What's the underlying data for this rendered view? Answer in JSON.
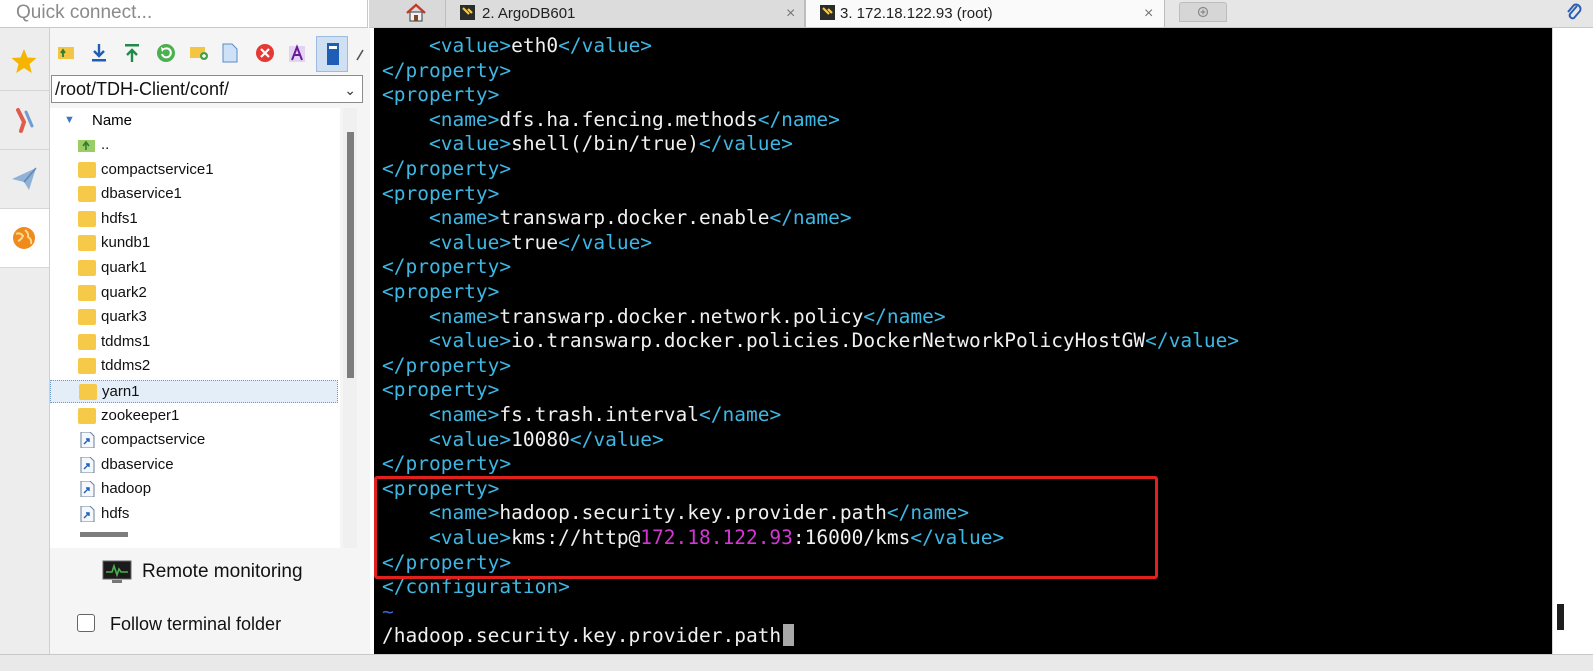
{
  "quick_connect": {
    "placeholder": "Quick connect..."
  },
  "tabs": [
    {
      "label": "",
      "icon": "home-icon",
      "active": false
    },
    {
      "label": "2. ArgoDB601",
      "icon": "terminal-tab-icon",
      "close": "×",
      "active": false
    },
    {
      "label": "3. 172.18.122.93 (root)",
      "icon": "terminal-tab-icon",
      "close": "×",
      "active": true
    },
    {
      "label": "",
      "icon": "new-tab-icon",
      "active": false
    }
  ],
  "left_strip": [
    "star-icon",
    "tools-icon",
    "paper-plane-icon",
    "globe-icon"
  ],
  "file_browser": {
    "toolbar": [
      "up-folder-icon",
      "download-icon",
      "upload-icon",
      "refresh-icon",
      "new-folder-icon",
      "new-file-icon",
      "delete-icon",
      "rename-icon",
      "toggle-view-icon"
    ],
    "path": "/root/TDH-Client/conf/",
    "name_header": "Name",
    "rows": [
      {
        "name": "..",
        "type": "parent"
      },
      {
        "name": "compactservice1",
        "type": "folder"
      },
      {
        "name": "dbaservice1",
        "type": "folder"
      },
      {
        "name": "hdfs1",
        "type": "folder"
      },
      {
        "name": "kundb1",
        "type": "folder"
      },
      {
        "name": "quark1",
        "type": "folder"
      },
      {
        "name": "quark2",
        "type": "folder"
      },
      {
        "name": "quark3",
        "type": "folder"
      },
      {
        "name": "tddms1",
        "type": "folder"
      },
      {
        "name": "tddms2",
        "type": "folder"
      },
      {
        "name": "yarn1",
        "type": "folder",
        "selected": true
      },
      {
        "name": "zookeeper1",
        "type": "folder"
      },
      {
        "name": "compactservice",
        "type": "link"
      },
      {
        "name": "dbaservice",
        "type": "link"
      },
      {
        "name": "hadoop",
        "type": "link"
      },
      {
        "name": "hdfs",
        "type": "link"
      }
    ],
    "remote_monitoring": "Remote monitoring",
    "follow_terminal_folder": "Follow terminal folder",
    "follow_checked": false
  },
  "terminal": {
    "lines": [
      "    <value>eth0</value>",
      "</property>",
      "<property>",
      "    <name>dfs.ha.fencing.methods</name>",
      "    <value>shell(/bin/true)</value>",
      "</property>",
      "<property>",
      "    <name>transwarp.docker.enable</name>",
      "    <value>true</value>",
      "</property>",
      "<property>",
      "    <name>transwarp.docker.network.policy</name>",
      "    <value>io.transwarp.docker.policies.DockerNetworkPolicyHostGW</value>",
      "</property>",
      "<property>",
      "    <name>fs.trash.interval</name>",
      "    <value>10080</value>",
      "</property>",
      "<property>",
      "    <name>hadoop.security.key.provider.path</name>",
      "    <value>kms://http@172.18.122.93:16000/kms</value>",
      "</property>",
      "</configuration>",
      "~",
      "/hadoop.security.key.provider.path"
    ],
    "highlighted_ip": "172.18.122.93",
    "colors": {
      "tag": "#3db7e4",
      "text": "#f0f0f0",
      "ip": "#d436d4",
      "tilde": "#3a63d6",
      "highlight": "#e0211d"
    }
  }
}
